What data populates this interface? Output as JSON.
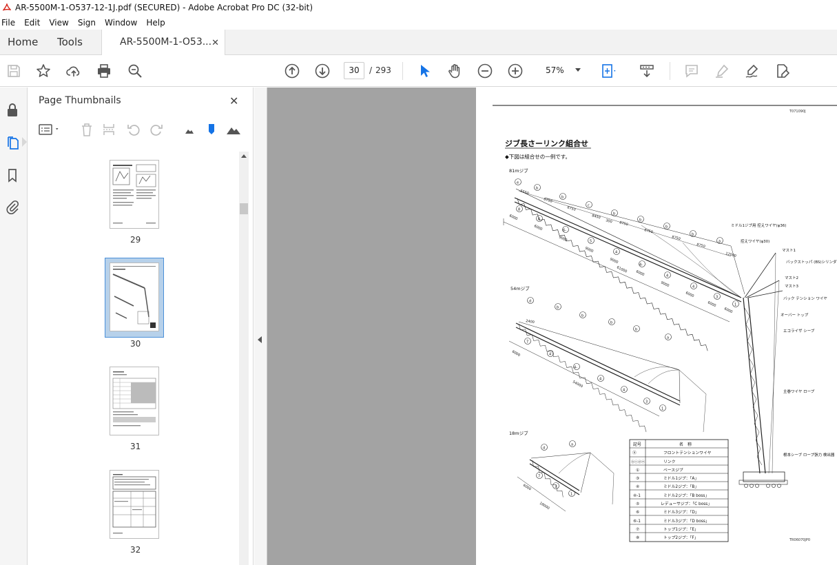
{
  "window": {
    "title": "AR-5500M-1-O537-12-1J.pdf (SECURED) - Adobe Acrobat Pro DC (32-bit)"
  },
  "menu": [
    "File",
    "Edit",
    "View",
    "Sign",
    "Window",
    "Help"
  ],
  "tabs": {
    "home": "Home",
    "tools": "Tools",
    "document": "AR-5500M-1-O53..."
  },
  "toolbar": {
    "current_page": "30",
    "page_separator": "/",
    "total_pages": "293",
    "zoom": "57%"
  },
  "thumbnail_panel": {
    "title": "Page Thumbnails",
    "pages": [
      {
        "number": "29"
      },
      {
        "number": "30",
        "selected": true
      },
      {
        "number": "31"
      },
      {
        "number": "32"
      }
    ]
  },
  "document": {
    "doc_code": "T071090J",
    "heading": "ジブ長さーリンク組合せ",
    "note": "◆下図は組合せの一例です。",
    "section_81": "81mジブ",
    "section_54": "54mジブ",
    "section_18": "18mジブ",
    "footer_code": "TR06070JP0",
    "dims_81": [
      "5550",
      "8750",
      "8750",
      "8450",
      "300",
      "8750",
      "8750",
      "8750",
      "8750",
      "12000",
      "6000",
      "6000",
      "9000",
      "9000",
      "9000",
      "61000",
      "6000",
      "9000",
      "6000",
      "6000",
      "6000"
    ],
    "dims_54": [
      "2400",
      "6000",
      "54000"
    ],
    "dims_18": [
      "6000",
      "18000"
    ],
    "callouts": [
      "ミドル1ジブ用 控えワイヤ(φ36)",
      "控えワイヤ(φ30)",
      "マスト1",
      "バックストッパ (BS)シリンダ",
      "マスト2",
      "マスト3",
      "バック テンション ワイヤ",
      "オーバー トップ",
      "エコライザ シーブ",
      "主巻ワイヤ ロープ",
      "根本シーブ ロープ張力 検出器"
    ],
    "legend": {
      "header_symbol": "記号",
      "header_name": "名　称",
      "rows": [
        {
          "symbol": "ⓐ",
          "name": "フロントテンションワイヤ"
        },
        {
          "symbol": "ⓑⓒⓓⓔ",
          "name": "リンク"
        },
        {
          "symbol": "①",
          "name": "ベースジブ"
        },
        {
          "symbol": "③",
          "name": "ミドル1ジブ：「A」"
        },
        {
          "symbol": "④",
          "name": "ミドル2ジブ：「B」"
        },
        {
          "symbol": "④-1",
          "name": "ミドル2ジブ：「B boss」"
        },
        {
          "symbol": "⑤",
          "name": "レデューサジブ：「C boss」"
        },
        {
          "symbol": "⑥",
          "name": "ミドル3ジブ：「D」"
        },
        {
          "symbol": "⑥-1",
          "name": "ミドル3ジブ：「D boss」"
        },
        {
          "symbol": "⑦",
          "name": "トップ1ジブ：「E」"
        },
        {
          "symbol": "⑧",
          "name": "トップ2ジブ：「F」"
        }
      ]
    }
  }
}
